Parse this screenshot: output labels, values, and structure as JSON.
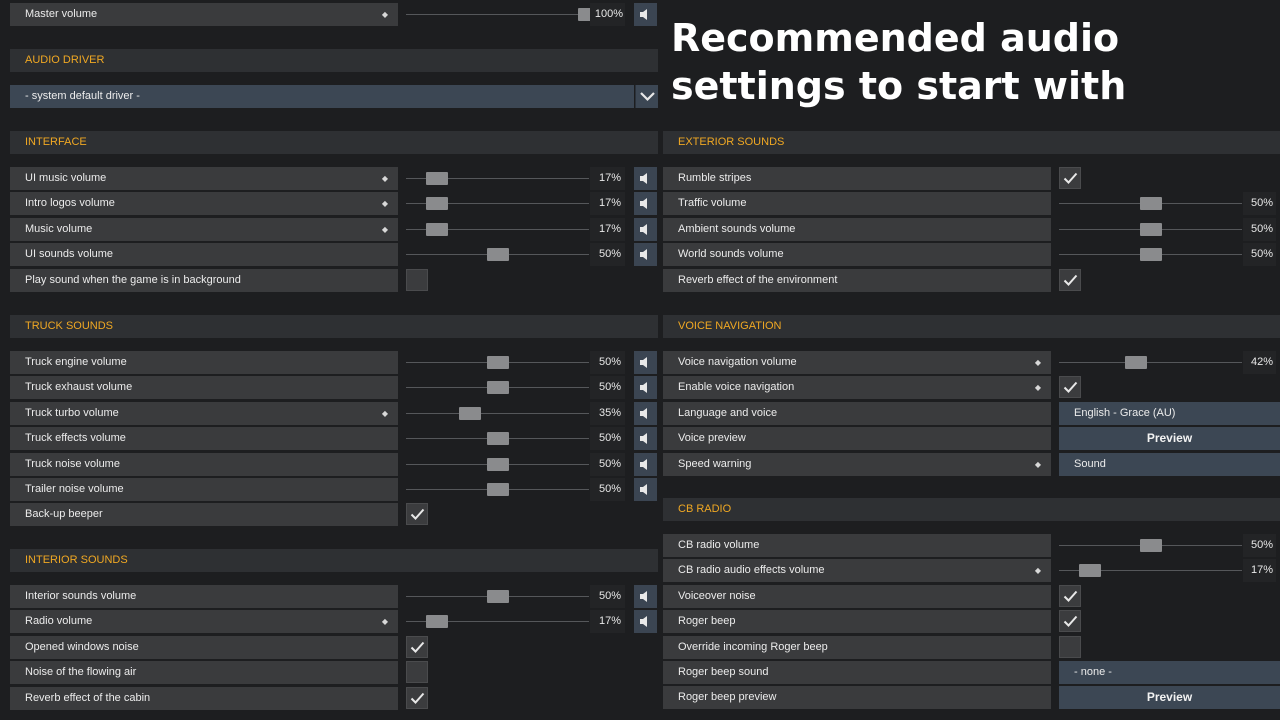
{
  "headline": "Recommended audio settings to start with",
  "master": {
    "label": "Master volume",
    "marked": true,
    "value": 1.0,
    "value_text": "100%",
    "muted_icon": "speaker-icon"
  },
  "audio_driver": {
    "header": "AUDIO DRIVER",
    "selected": "- system default driver -"
  },
  "interface": {
    "header": "INTERFACE",
    "rows": [
      {
        "name": "ui-music-volume",
        "label": "UI music volume",
        "marked": true,
        "kind": "slider",
        "value": 0.17,
        "value_text": "17%"
      },
      {
        "name": "intro-logos-volume",
        "label": "Intro logos volume",
        "marked": true,
        "kind": "slider",
        "value": 0.17,
        "value_text": "17%"
      },
      {
        "name": "music-volume",
        "label": "Music volume",
        "marked": true,
        "kind": "slider",
        "value": 0.17,
        "value_text": "17%"
      },
      {
        "name": "ui-sounds-volume",
        "label": "UI sounds volume",
        "marked": false,
        "kind": "slider",
        "value": 0.5,
        "value_text": "50%"
      },
      {
        "name": "play-sound-in-background",
        "label": "Play sound when the game is in background",
        "marked": false,
        "kind": "checkbox",
        "checked": false
      }
    ]
  },
  "truck_sounds": {
    "header": "TRUCK SOUNDS",
    "rows": [
      {
        "name": "truck-engine-volume",
        "label": "Truck engine volume",
        "marked": false,
        "kind": "slider",
        "value": 0.5,
        "value_text": "50%"
      },
      {
        "name": "truck-exhaust-volume",
        "label": "Truck exhaust volume",
        "marked": false,
        "kind": "slider",
        "value": 0.5,
        "value_text": "50%"
      },
      {
        "name": "truck-turbo-volume",
        "label": "Truck turbo volume",
        "marked": true,
        "kind": "slider",
        "value": 0.35,
        "value_text": "35%"
      },
      {
        "name": "truck-effects-volume",
        "label": "Truck effects volume",
        "marked": false,
        "kind": "slider",
        "value": 0.5,
        "value_text": "50%"
      },
      {
        "name": "truck-noise-volume",
        "label": "Truck noise volume",
        "marked": false,
        "kind": "slider",
        "value": 0.5,
        "value_text": "50%"
      },
      {
        "name": "trailer-noise-volume",
        "label": "Trailer noise volume",
        "marked": false,
        "kind": "slider",
        "value": 0.5,
        "value_text": "50%"
      },
      {
        "name": "back-up-beeper",
        "label": "Back-up beeper",
        "marked": false,
        "kind": "checkbox",
        "checked": true
      }
    ]
  },
  "interior_sounds": {
    "header": "INTERIOR SOUNDS",
    "rows": [
      {
        "name": "interior-sounds-volume",
        "label": "Interior sounds volume",
        "marked": false,
        "kind": "slider",
        "value": 0.5,
        "value_text": "50%"
      },
      {
        "name": "radio-volume",
        "label": "Radio volume",
        "marked": true,
        "kind": "slider",
        "value": 0.17,
        "value_text": "17%"
      },
      {
        "name": "opened-windows-noise",
        "label": "Opened windows noise",
        "marked": false,
        "kind": "checkbox",
        "checked": true
      },
      {
        "name": "noise-of-flowing-air",
        "label": "Noise of the flowing air",
        "marked": false,
        "kind": "checkbox",
        "checked": false
      },
      {
        "name": "reverb-effect-cabin",
        "label": "Reverb effect of the cabin",
        "marked": false,
        "kind": "checkbox",
        "checked": true
      }
    ]
  },
  "exterior_sounds": {
    "header": "EXTERIOR SOUNDS",
    "rows": [
      {
        "name": "rumble-stripes",
        "label": "Rumble stripes",
        "marked": false,
        "kind": "checkbox",
        "checked": true
      },
      {
        "name": "traffic-volume",
        "label": "Traffic volume",
        "marked": false,
        "kind": "slider",
        "value": 0.5,
        "value_text": "50%"
      },
      {
        "name": "ambient-sounds-volume",
        "label": "Ambient sounds volume",
        "marked": false,
        "kind": "slider",
        "value": 0.5,
        "value_text": "50%"
      },
      {
        "name": "world-sounds-volume",
        "label": "World sounds volume",
        "marked": false,
        "kind": "slider",
        "value": 0.5,
        "value_text": "50%"
      },
      {
        "name": "reverb-effect-environment",
        "label": "Reverb effect of the environment",
        "marked": false,
        "kind": "checkbox",
        "checked": true
      }
    ]
  },
  "voice_navigation": {
    "header": "VOICE NAVIGATION",
    "rows": [
      {
        "name": "voice-navigation-volume",
        "label": "Voice navigation volume",
        "marked": true,
        "kind": "slider",
        "value": 0.42,
        "value_text": "42%"
      },
      {
        "name": "enable-voice-navigation",
        "label": "Enable voice navigation",
        "marked": true,
        "kind": "checkbox",
        "checked": true
      },
      {
        "name": "language-and-voice",
        "label": "Language and voice",
        "marked": false,
        "kind": "select",
        "value_text": "English - Grace (AU)"
      },
      {
        "name": "voice-preview",
        "label": "Voice preview",
        "marked": false,
        "kind": "button",
        "value_text": "Preview"
      },
      {
        "name": "speed-warning",
        "label": "Speed warning",
        "marked": true,
        "kind": "select",
        "value_text": "Sound"
      }
    ]
  },
  "cb_radio": {
    "header": "CB RADIO",
    "rows": [
      {
        "name": "cb-radio-volume",
        "label": "CB radio volume",
        "marked": false,
        "kind": "slider",
        "value": 0.5,
        "value_text": "50%"
      },
      {
        "name": "cb-radio-audio-effects-volume",
        "label": "CB radio audio effects volume",
        "marked": true,
        "kind": "slider",
        "value": 0.17,
        "value_text": "17%"
      },
      {
        "name": "voiceover-noise",
        "label": "Voiceover noise",
        "marked": false,
        "kind": "checkbox",
        "checked": true
      },
      {
        "name": "roger-beep",
        "label": "Roger beep",
        "marked": false,
        "kind": "checkbox",
        "checked": true
      },
      {
        "name": "override-incoming-roger-beep",
        "label": "Override incoming Roger beep",
        "marked": false,
        "kind": "checkbox",
        "checked": false
      },
      {
        "name": "roger-beep-sound",
        "label": "Roger beep sound",
        "marked": false,
        "kind": "select",
        "value_text": "- none -"
      },
      {
        "name": "roger-beep-preview",
        "label": "Roger beep preview",
        "marked": false,
        "kind": "button",
        "value_text": "Preview"
      }
    ]
  },
  "colors": {
    "accent": "#f0a823",
    "row_bg": "#3a3b3d",
    "header_bg": "#2e3033",
    "control_bg": "#3c4754"
  },
  "icons": {
    "marker": "diamond-icon",
    "mute": "speaker-icon",
    "check": "checkmark-icon",
    "dropdown": "chevron-down-icon"
  }
}
